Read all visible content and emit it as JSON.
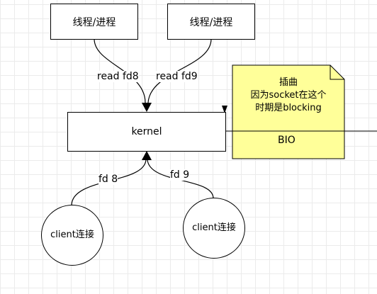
{
  "nodes": {
    "thread_left": "线程/进程",
    "thread_right": "线程/进程",
    "kernel": "kernel",
    "client_left": "client连接",
    "client_right": "client连接"
  },
  "edges": {
    "read_left": "read fd8",
    "read_right": "read fd9",
    "fd_left": "fd 8",
    "fd_right": "fd 9"
  },
  "note": {
    "line1": "插曲",
    "line2": "因为socket在这个",
    "line3": "时期是blocking",
    "bio": "BIO"
  },
  "colors": {
    "note_fill": "#ffff99",
    "stroke": "#000000",
    "grid": "#ebebeb"
  }
}
